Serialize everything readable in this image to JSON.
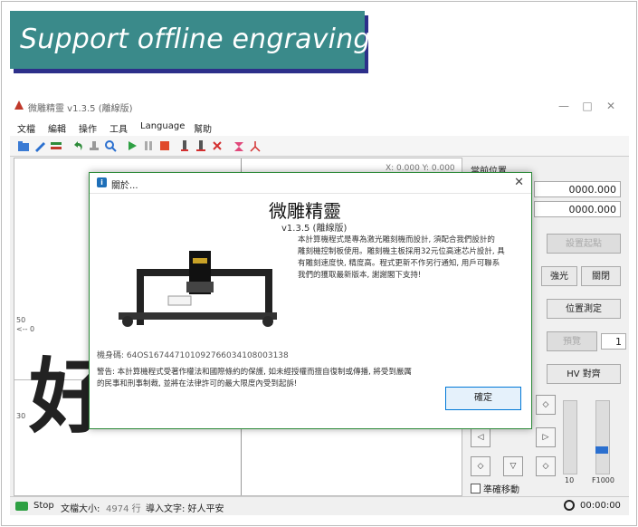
{
  "banner": {
    "text": "Support offline engraving"
  },
  "app": {
    "title": "微雕精靈  v1.3.5 (離線版)",
    "menu": [
      "文檔",
      "編輯",
      "操作",
      "工具",
      "Language",
      "幫助"
    ],
    "canvas": {
      "coord_readout": "X: 0.000 Y: 0.000",
      "big_char": "好",
      "axis_label_1": "50",
      "axis_label_2": "<-- 0",
      "axis_label_3": "30"
    },
    "right_panel": {
      "title": "當前位置",
      "x_value": "0000.000",
      "y_value": "0000.000",
      "btn_set_origin": "設置起點",
      "btn_strong_light": "強光",
      "btn_close": "關閉",
      "btn_position": "位置測定",
      "btn_preview": "預覽",
      "btn_spin_value": "1",
      "btn_hv": "HV 對齊",
      "slider_left_label": "10",
      "slider_right_label": "F1000",
      "checkbox_label": "準確移動"
    },
    "status": {
      "stop": "Stop",
      "doc_size_label": "文檔大小:",
      "doc_size_value": "4974 行",
      "import_text": "導入文字: 好人平安",
      "time": "00:00:00"
    }
  },
  "dialog": {
    "title": "關於...",
    "app_name": "微雕精靈",
    "version": "v1.3.5 (離線版)",
    "description": [
      "本計算機程式是專為激光雕刻機而設計, 須配合我們設計的",
      "雕刻機控制板使用。雕刻機主板採用32元位高速芯片設計, 具",
      "有雕刻速度快, 精度高。程式更新不作另行通知, 用戶可聯系",
      "我們的獲取最新版本, 謝謝閣下支持!"
    ],
    "machine_code": "機身碼: 64OS167447101092766034108003138",
    "warning": [
      "警告: 本計算機程式受著作權法和國際條約的保護, 如未經授權而擅自復制或傳播, 將受到嚴厲",
      "的民事和刑事制裁, 並將在法律許可的最大限度內受到起訴!"
    ],
    "ok_label": "確定"
  },
  "colors": {
    "banner": "#3a8a8a",
    "banner_shadow": "#2d2f8a",
    "dialog_border": "#2e8b3a"
  }
}
